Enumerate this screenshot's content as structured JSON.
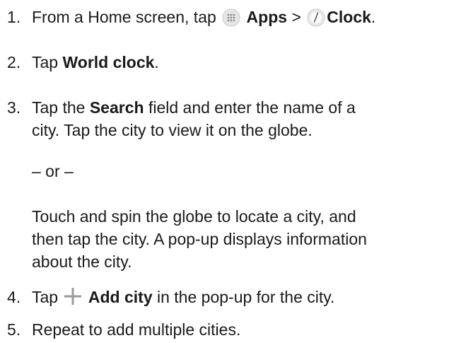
{
  "steps": [
    {
      "number": "1.",
      "parts": {
        "a": "From a Home screen, tap",
        "b": "Apps",
        "c": ">",
        "d": "Clock",
        "e": "."
      },
      "icons": [
        "apps-grid-icon",
        "clock-icon"
      ]
    },
    {
      "number": "2.",
      "parts": {
        "a": "Tap",
        "b": "World clock",
        "c": "."
      }
    },
    {
      "number": "3.",
      "parts": {
        "a": "Tap the",
        "b": "Search",
        "c": "field and enter the name of a",
        "line2": "city. Tap the city to view it on the globe."
      },
      "or": "– or –",
      "alt_lines": [
        "Touch and spin the globe to locate a city, and",
        "then tap the city. A pop-up displays information",
        "about the city."
      ]
    },
    {
      "number": "4.",
      "parts": {
        "a": "Tap",
        "b": "Add city",
        "c": "in the pop-up for the city."
      },
      "icons": [
        "plus-icon"
      ]
    },
    {
      "number": "5.",
      "parts": {
        "a": "Repeat to add multiple cities."
      }
    }
  ],
  "colors": {
    "text": "#1a1a1a",
    "icon_gray": "#9a9a9a",
    "icon_bg": "#e6e6e6"
  }
}
